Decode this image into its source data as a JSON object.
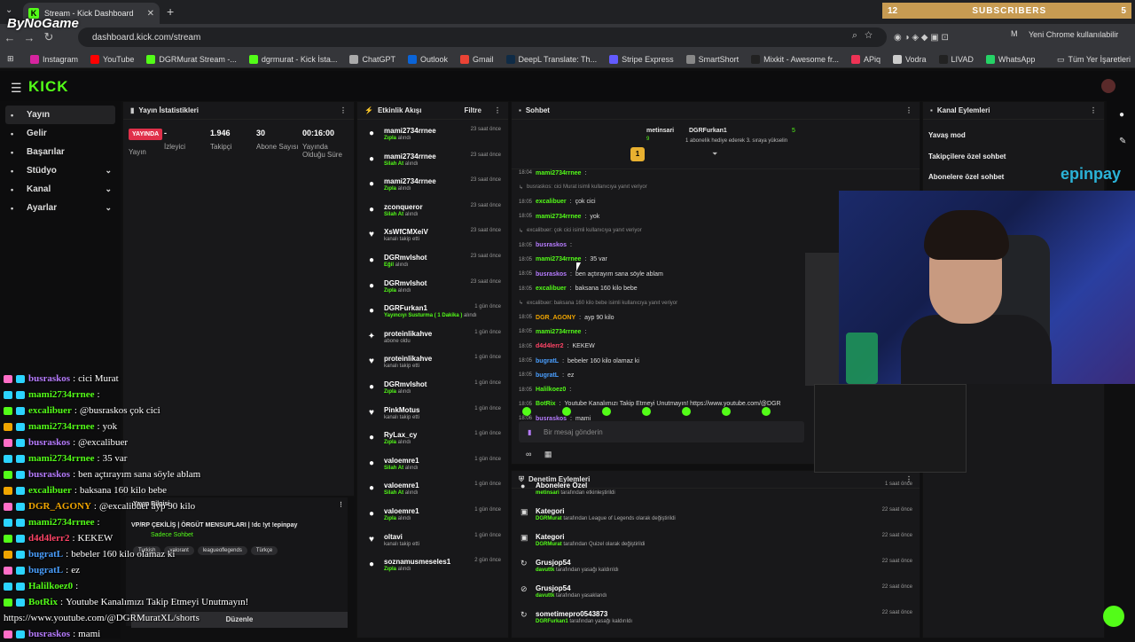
{
  "browser": {
    "tab_title": "Stream - Kick Dashboard",
    "url": "dashboard.kick.com/stream",
    "profile": "Yeni Chrome kullanılabilir",
    "profile_initial": "M",
    "overlay_logo": "ByNoGame",
    "bookmarks": [
      {
        "label": "Instagram",
        "color": "#d6249f"
      },
      {
        "label": "YouTube",
        "color": "#ff0000"
      },
      {
        "label": "DGRMurat Stream -...",
        "color": "#53fc18"
      },
      {
        "label": "dgrmurat - Kick İsta...",
        "color": "#53fc18"
      },
      {
        "label": "ChatGPT",
        "color": "#aaaaaa"
      },
      {
        "label": "Outlook",
        "color": "#0a64d8"
      },
      {
        "label": "Gmail",
        "color": "#ea4335"
      },
      {
        "label": "DeepL Translate: Th...",
        "color": "#0f2b46"
      },
      {
        "label": "Stripe Express",
        "color": "#635bff"
      },
      {
        "label": "SmartShort",
        "color": "#888888"
      },
      {
        "label": "Mixkit - Awesome fr...",
        "color": "#222222"
      },
      {
        "label": "APiq",
        "color": "#e35"
      },
      {
        "label": "Vodra",
        "color": "#ccc"
      },
      {
        "label": "LIVAD",
        "color": "#222"
      },
      {
        "label": "WhatsApp",
        "color": "#25d366"
      }
    ],
    "bookmarks_right": "Tüm Yer İşaretleri"
  },
  "subscribers": {
    "left": "12",
    "label": "SUBSCRIBERS",
    "right": "5"
  },
  "sidebar": {
    "items": [
      {
        "label": "Yayın",
        "icon": "broadcast-icon",
        "chev": ""
      },
      {
        "label": "Gelir",
        "icon": "revenue-icon",
        "chev": ""
      },
      {
        "label": "Başarılar",
        "icon": "trophy-icon",
        "chev": ""
      },
      {
        "label": "Stüdyo",
        "icon": "studio-icon",
        "chev": "⌄"
      },
      {
        "label": "Kanal",
        "icon": "channel-icon",
        "chev": "⌄"
      },
      {
        "label": "Ayarlar",
        "icon": "settings-icon",
        "chev": "⌄"
      }
    ]
  },
  "stats": {
    "title": "Yayın İstatistikleri",
    "live": "YAYINDA",
    "live_label": "Yayın",
    "items": [
      {
        "value": "-",
        "label": "İzleyici"
      },
      {
        "value": "1.946",
        "label": "Takipçi"
      },
      {
        "value": "30",
        "label": "Abone Sayısı"
      },
      {
        "value": "00:16:00",
        "label": "Yayında Olduğu Süre"
      }
    ]
  },
  "activity": {
    "title": "Etkinlik Akışı",
    "filter": "Filtre",
    "items": [
      {
        "icon": "user",
        "name": "mami2734rrnee",
        "b": "Zıpla",
        "s": " alındı",
        "time": "23 saat önce"
      },
      {
        "icon": "user",
        "name": "mami2734rrnee",
        "b": "Silah At",
        "s": " alındı",
        "time": "23 saat önce"
      },
      {
        "icon": "user",
        "name": "mami2734rrnee",
        "b": "Zıpla",
        "s": " alındı",
        "time": "23 saat önce"
      },
      {
        "icon": "user",
        "name": "zconqueror",
        "b": "Silah At",
        "s": " alındı",
        "time": "23 saat önce"
      },
      {
        "icon": "heart",
        "name": "XsWfCMXeiV",
        "b": "",
        "s": "kanalı takip etti",
        "time": "23 saat önce"
      },
      {
        "icon": "user",
        "name": "DGRmvlshot",
        "b": "Eğil",
        "s": " alındı",
        "time": "23 saat önce"
      },
      {
        "icon": "user",
        "name": "DGRmvlshot",
        "b": "Zıpla",
        "s": " alındı",
        "time": "23 saat önce"
      },
      {
        "icon": "user",
        "name": "DGRFurkan1",
        "b": "Yayıncıyı Susturma ( 1 Dakika )",
        "s": " alındı",
        "time": "1 gün önce"
      },
      {
        "icon": "star",
        "name": "proteinlikahve",
        "b": "",
        "s": "abone oldu",
        "time": "1 gün önce"
      },
      {
        "icon": "heart",
        "name": "proteinlikahve",
        "b": "",
        "s": "kanalı takip etti",
        "time": "1 gün önce"
      },
      {
        "icon": "user",
        "name": "DGRmvlshot",
        "b": "Zıpla",
        "s": " alındı",
        "time": "1 gün önce"
      },
      {
        "icon": "heart",
        "name": "PinkMotus",
        "b": "",
        "s": "kanalı takip etti",
        "time": "1 gün önce"
      },
      {
        "icon": "user",
        "name": "RyLax_cy",
        "b": "Zıpla",
        "s": " alındı",
        "time": "1 gün önce"
      },
      {
        "icon": "user",
        "name": "valoemre1",
        "b": "Silah At",
        "s": " alındı",
        "time": "1 gün önce"
      },
      {
        "icon": "user",
        "name": "valoemre1",
        "b": "Silah At",
        "s": " alındı",
        "time": "1 gün önce"
      },
      {
        "icon": "user",
        "name": "valoemre1",
        "b": "Zıpla",
        "s": " alındı",
        "time": "1 gün önce"
      },
      {
        "icon": "heart",
        "name": "oltavi",
        "b": "",
        "s": "kanalı takip etti",
        "time": "1 gün önce"
      },
      {
        "icon": "user",
        "name": "soznamusmeseles1",
        "b": "Zıpla",
        "s": " alındı",
        "time": "2 gün önce"
      }
    ]
  },
  "chat": {
    "title": "Sohbet",
    "pinned_user": "metinsari",
    "pinned_count": "9",
    "gift_user": "DGRFurkan1",
    "gift_count": "5",
    "gift_text": "1 aboneIik hediye ederek 3. sıraya yükselin",
    "lines": [
      {
        "t": "18:04",
        "u": "mami2734rrnee",
        "c": "#53fc18",
        "m": "",
        "reply": ""
      },
      {
        "t": "",
        "u": "",
        "c": "",
        "m": "",
        "reply": "busraskos: cici Murat isimli kullanıcıya yanıt veriyor"
      },
      {
        "t": "18:05",
        "u": "excalibuer",
        "c": "#53fc18",
        "m": "çok cici",
        "reply": ""
      },
      {
        "t": "18:05",
        "u": "mami2734rrnee",
        "c": "#53fc18",
        "m": "yok",
        "reply": ""
      },
      {
        "t": "",
        "u": "",
        "c": "",
        "m": "",
        "reply": "excalibuer: çok cici isimli kullanıcıya yanıt veriyor"
      },
      {
        "t": "18:05",
        "u": "busraskos",
        "c": "#b77cff",
        "m": "",
        "reply": ""
      },
      {
        "t": "18:05",
        "u": "mami2734rrnee",
        "c": "#53fc18",
        "m": "35 var",
        "reply": ""
      },
      {
        "t": "18:05",
        "u": "busraskos",
        "c": "#b77cff",
        "m": "ben açtırayım sana söyle ablam",
        "reply": ""
      },
      {
        "t": "18:05",
        "u": "excalibuer",
        "c": "#53fc18",
        "m": "baksana 160 kilo bebe",
        "reply": ""
      },
      {
        "t": "",
        "u": "",
        "c": "",
        "m": "",
        "reply": "excalibuer: baksana 160 kilo bebe isimli kullanıcıya yanıt veriyor"
      },
      {
        "t": "18:05",
        "u": "DGR_AGONY",
        "c": "#f0a500",
        "m": "ayp 90 kilo",
        "reply": ""
      },
      {
        "t": "18:05",
        "u": "mami2734rrnee",
        "c": "#53fc18",
        "m": "",
        "reply": ""
      },
      {
        "t": "18:05",
        "u": "d4d4lerr2",
        "c": "#ff4466",
        "m": "KEKEW",
        "reply": ""
      },
      {
        "t": "18:05",
        "u": "bugratL",
        "c": "#4a9fff",
        "m": "bebeler 160 kilo olamaz ki",
        "reply": ""
      },
      {
        "t": "18:05",
        "u": "bugratL",
        "c": "#4a9fff",
        "m": "ez",
        "reply": ""
      },
      {
        "t": "18:05",
        "u": "Halilkoez0",
        "c": "#53fc18",
        "m": "",
        "reply": ""
      },
      {
        "t": "18:05",
        "u": "BotRix",
        "c": "#53fc18",
        "m": "Youtube Kanalımızı Takip Etmeyi Unutmayın! https://www.youtube.com/@DGR",
        "reply": ""
      },
      {
        "t": "18:06",
        "u": "busraskos",
        "c": "#b77cff",
        "m": "mami",
        "reply": ""
      }
    ],
    "input_placeholder": "Bir mesaj gönderin"
  },
  "moderation": {
    "title": "Denetim Eylemleri",
    "items": [
      {
        "icon": "user-icon",
        "name": "Abonelere Özel",
        "by": "metinsari",
        "action": " tarafından etkinleştirildi",
        "time": "1 saat önce"
      },
      {
        "icon": "category-icon",
        "name": "Kategori",
        "by": "DGRMurat",
        "action": " tarafından League of Legends olarak değiştirildi",
        "time": "22 saat önce"
      },
      {
        "icon": "category-icon",
        "name": "Kategori",
        "by": "DGRMurat",
        "action": " tarafından Quizel olarak değiştirildi",
        "time": "22 saat önce"
      },
      {
        "icon": "unban-icon",
        "name": "Grusjop54",
        "by": "davuttk",
        "action": " tarafından yasağı kaldırıldı",
        "time": "22 saat önce"
      },
      {
        "icon": "ban-icon",
        "name": "Grusjop54",
        "by": "davuttk",
        "action": " tarafından yasaklandı",
        "time": "22 saat önce"
      },
      {
        "icon": "unban-icon",
        "name": "sometimepro0543873",
        "by": "DGRFurkan1",
        "action": " tarafından yasağı kaldırıldı",
        "time": "22 saat önce"
      }
    ]
  },
  "channel_actions": {
    "title": "Kanal Eylemleri",
    "items": [
      "Yavaş mod",
      "Takipçilere özel sohbet",
      "Abonelere özel sohbet"
    ]
  },
  "overlay": {
    "epin": "epinpay",
    "chat": [
      {
        "u": "busraskos",
        "c": "#b77cff",
        "m": "cici Murat"
      },
      {
        "u": "mami2734rrnee",
        "c": "#53fc18",
        "m": ""
      },
      {
        "u": "excalibuer",
        "c": "#53fc18",
        "m": "@busraskos çok cici"
      },
      {
        "u": "mami2734rrnee",
        "c": "#53fc18",
        "m": "yok"
      },
      {
        "u": "busraskos",
        "c": "#b77cff",
        "m": "@excalibuer"
      },
      {
        "u": "mami2734rrnee",
        "c": "#53fc18",
        "m": "35 var"
      },
      {
        "u": "busraskos",
        "c": "#b77cff",
        "m": "ben açtırayım sana söyle ablam"
      },
      {
        "u": "excalibuer",
        "c": "#53fc18",
        "m": "baksana 160 kilo bebe"
      },
      {
        "u": "DGR_AGONY",
        "c": "#f0a500",
        "m": "@excalibuer ayp 90 kilo"
      },
      {
        "u": "mami2734rrnee",
        "c": "#53fc18",
        "m": ""
      },
      {
        "u": "d4d4lerr2",
        "c": "#ff4466",
        "m": "KEKEW"
      },
      {
        "u": "bugratL",
        "c": "#4a9fff",
        "m": "bebeler 160 kilo olamaz ki"
      },
      {
        "u": "bugratL",
        "c": "#4a9fff",
        "m": "ez"
      },
      {
        "u": "Halilkoez0",
        "c": "#53fc18",
        "m": ""
      },
      {
        "u": "BotRix",
        "c": "#53fc18",
        "m": "Youtube Kanalımızı Takip Etmeyi Unutmayın!"
      },
      {
        "u": "",
        "c": "#ffffff",
        "m": "https://www.youtube.com/@DGRMuratXL/shorts"
      },
      {
        "u": "busraskos",
        "c": "#b77cff",
        "m": "mami"
      }
    ]
  },
  "stream_info": {
    "title": "Yayın Bilgisi",
    "stream_title": "VP/RP ÇEKİLİŞ | ÖRGÜT MENSUPLARI | !dc !yt !epinpay",
    "mode": "Sadece Sohbet",
    "tags": [
      "Turkish",
      "valorant",
      "leagueoflegends",
      "Türkçe"
    ],
    "edit": "Düzenle"
  }
}
